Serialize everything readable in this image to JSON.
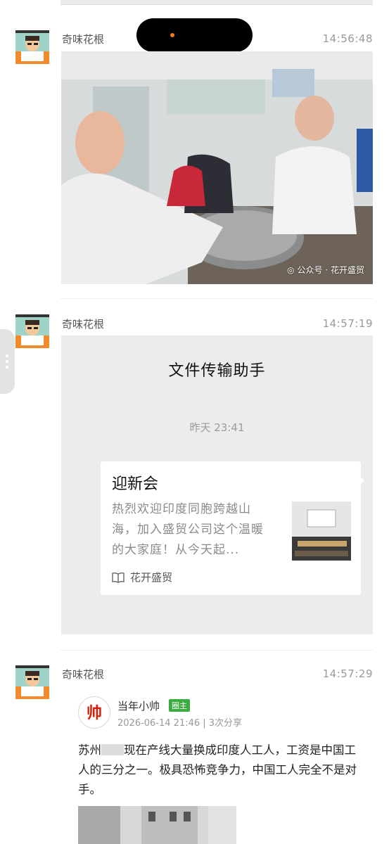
{
  "messages": [
    {
      "sender": "奇味花根",
      "time": "14:56:48"
    },
    {
      "sender": "奇味花根",
      "time": "14:57:19"
    },
    {
      "sender": "奇味花根",
      "time": "14:57:29"
    }
  ],
  "photo_watermark": "公众号 · 花开盛贸",
  "file_transfer": {
    "title": "文件传输助手",
    "date": "昨天 23:41",
    "article": {
      "title": "迎新会",
      "excerpt": "热烈欢迎印度同胞跨越山海，加入盛贸公司这个温暖的大家庭！从今天起...",
      "source": "花开盛贸"
    }
  },
  "weibo_post": {
    "author": "当年小帅",
    "badge": "圈主",
    "meta": "2026-06-14 21:46 | 3次分享",
    "avatar_char": "帅",
    "text_prefix": "苏州",
    "text": "现在产线大量换成印度人工人，工资是中国工人的三分之一。极具恐怖竞争力，中国工人完全不是对手。"
  },
  "colors": {
    "badge_green": "#3cab40",
    "card_bg": "#ececec",
    "avatar_red": "#d81e06"
  }
}
